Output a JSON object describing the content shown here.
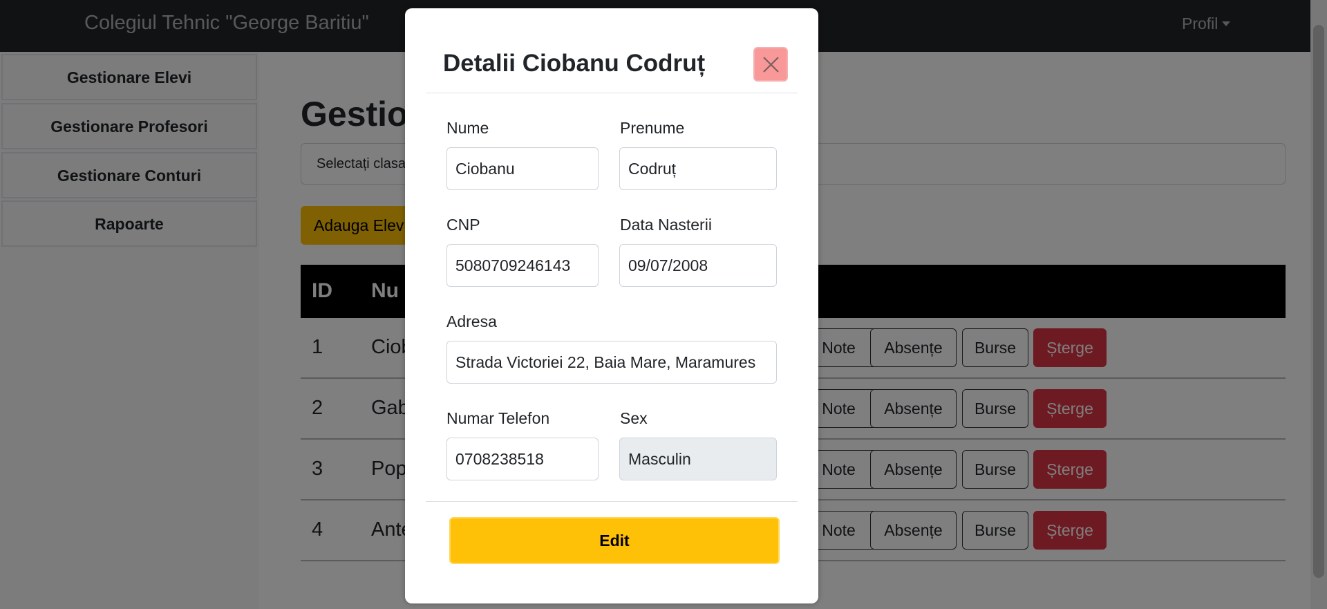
{
  "navbar": {
    "brand": "Colegiul Tehnic \"George Baritiu\"",
    "profile_label": "Profil"
  },
  "sidebar": {
    "items": [
      {
        "label": "Gestionare Elevi"
      },
      {
        "label": "Gestionare Profesori"
      },
      {
        "label": "Gestionare Conturi"
      },
      {
        "label": "Rapoarte"
      }
    ]
  },
  "main": {
    "title": "Gestion",
    "class_select_placeholder": "Selectați clasa",
    "add_button": "Adauga Elev",
    "table": {
      "headers": {
        "id": "ID",
        "name": "Nu"
      },
      "rows": [
        {
          "id": "1",
          "name": "Ciob"
        },
        {
          "id": "2",
          "name": "Gab"
        },
        {
          "id": "3",
          "name": "Pop"
        },
        {
          "id": "4",
          "name": "Ante"
        }
      ],
      "actions": {
        "note": "Note",
        "absente": "Absențe",
        "burse": "Burse",
        "sterge": "Șterge"
      }
    }
  },
  "modal": {
    "title": "Detalii Ciobanu Codruț",
    "fields": {
      "nume": {
        "label": "Nume",
        "value": "Ciobanu"
      },
      "prenume": {
        "label": "Prenume",
        "value": "Codruț"
      },
      "cnp": {
        "label": "CNP",
        "value": "5080709246143"
      },
      "data_nasterii": {
        "label": "Data Nasterii",
        "value": "09/07/2008"
      },
      "adresa": {
        "label": "Adresa",
        "value": "Strada Victoriei 22, Baia Mare, Maramures"
      },
      "telefon": {
        "label": "Numar Telefon",
        "value": "0708238518"
      },
      "sex": {
        "label": "Sex",
        "value": "Masculin"
      }
    },
    "edit_button": "Edit"
  },
  "colors": {
    "navbar": "#212529",
    "warning": "#ffc107",
    "danger": "#dc3545",
    "close_button": "#f89898"
  },
  "icons": {
    "close": "close-icon",
    "profile_caret": "caret-down-icon"
  }
}
